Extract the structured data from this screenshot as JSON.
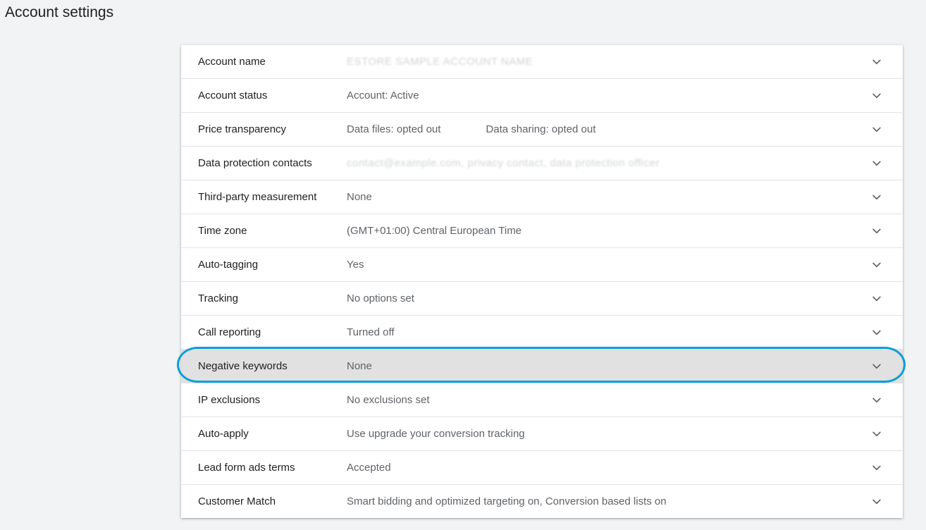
{
  "page": {
    "title": "Account settings"
  },
  "settings": [
    {
      "label": "Account name",
      "value": "ESTORE SAMPLE ACCOUNT NAME",
      "value2": null,
      "blurred": true,
      "highlighted": false
    },
    {
      "label": "Account status",
      "value": "Account: Active",
      "value2": null,
      "blurred": false,
      "highlighted": false
    },
    {
      "label": "Price transparency",
      "value": "Data files: opted out",
      "value2": "Data sharing: opted out",
      "blurred": false,
      "highlighted": false
    },
    {
      "label": "Data protection contacts",
      "value": "contact@example.com, privacy contact, data protection officer",
      "value2": null,
      "blurred": true,
      "highlighted": false
    },
    {
      "label": "Third-party measurement",
      "value": "None",
      "value2": null,
      "blurred": false,
      "highlighted": false
    },
    {
      "label": "Time zone",
      "value": "(GMT+01:00) Central European Time",
      "value2": null,
      "blurred": false,
      "highlighted": false
    },
    {
      "label": "Auto-tagging",
      "value": "Yes",
      "value2": null,
      "blurred": false,
      "highlighted": false
    },
    {
      "label": "Tracking",
      "value": "No options set",
      "value2": null,
      "blurred": false,
      "highlighted": false
    },
    {
      "label": "Call reporting",
      "value": "Turned off",
      "value2": null,
      "blurred": false,
      "highlighted": false
    },
    {
      "label": "Negative keywords",
      "value": "None",
      "value2": null,
      "blurred": false,
      "highlighted": true
    },
    {
      "label": "IP exclusions",
      "value": "No exclusions set",
      "value2": null,
      "blurred": false,
      "highlighted": false
    },
    {
      "label": "Auto-apply",
      "value": "Use upgrade your conversion tracking",
      "value2": null,
      "blurred": false,
      "highlighted": false
    },
    {
      "label": "Lead form ads terms",
      "value": "Accepted",
      "value2": null,
      "blurred": false,
      "highlighted": false
    },
    {
      "label": "Customer Match",
      "value": "Smart bidding and optimized targeting on, Conversion based lists on",
      "value2": null,
      "blurred": false,
      "highlighted": false
    }
  ],
  "icons": {
    "expand": "chevron-down-icon"
  },
  "colors": {
    "background": "#f1f3f4",
    "highlight_row": "#e1e1e1",
    "annotation_ring": "#0a9fd8"
  }
}
